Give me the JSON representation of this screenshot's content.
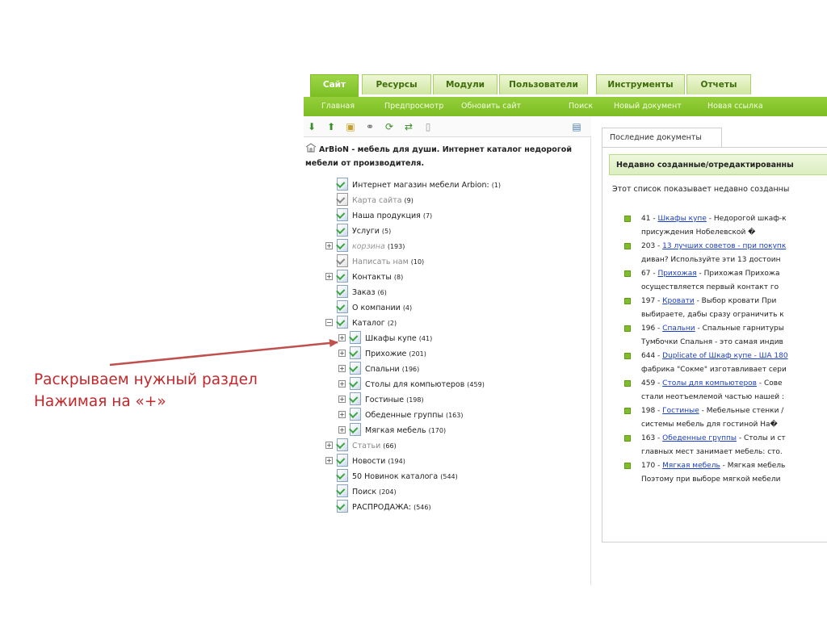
{
  "tabs": [
    {
      "label": "Сайт",
      "active": true
    },
    {
      "label": "Ресурсы"
    },
    {
      "label": "Модули"
    },
    {
      "label": "Пользователи"
    },
    {
      "label": "Инструменты"
    },
    {
      "label": "Отчеты"
    }
  ],
  "subnav": [
    "Главная",
    "Предпросмотр",
    "Обновить сайт",
    "Поиск",
    "Новый документ",
    "Новая ссылка"
  ],
  "tree": {
    "toolbar_icons": [
      "arrow-down-icon",
      "arrow-up-icon",
      "new-document-icon",
      "new-link-icon",
      "refresh-icon",
      "sort-icon",
      "trash-icon",
      "collapse-panel-icon"
    ],
    "root_title": "ArBioN - мебель для души. Интернет каталог недорогой мебели от производителя.",
    "nodes": [
      {
        "label": "Интернет магазин мебели Arbion:",
        "count": "(1)"
      },
      {
        "label": "Карта сайта",
        "count": "(9)"
      },
      {
        "label": "Наша продукция",
        "count": "(7)"
      },
      {
        "label": "Услуги",
        "count": "(5)"
      },
      {
        "label": "корзина",
        "count": "(193)"
      },
      {
        "label": "Написать нам",
        "count": "(10)"
      },
      {
        "label": "Контакты",
        "count": "(8)"
      },
      {
        "label": "Заказ",
        "count": "(6)"
      },
      {
        "label": "О компании",
        "count": "(4)"
      },
      {
        "label": "Каталог",
        "count": "(2)"
      },
      {
        "label": "Шкафы купе",
        "count": "(41)"
      },
      {
        "label": "Прихожие",
        "count": "(201)"
      },
      {
        "label": "Спальни",
        "count": "(196)"
      },
      {
        "label": "Столы для компьютеров",
        "count": "(459)"
      },
      {
        "label": "Гостиные",
        "count": "(198)"
      },
      {
        "label": "Обеденные группы",
        "count": "(163)"
      },
      {
        "label": "Мягкая мебель",
        "count": "(170)"
      },
      {
        "label": "Статьи",
        "count": "(66)"
      },
      {
        "label": "Новости",
        "count": "(194)"
      },
      {
        "label": "50 Новинок каталога",
        "count": "(544)"
      },
      {
        "label": "Поиск",
        "count": "(204)"
      },
      {
        "label": "РАСПРОДАЖА:",
        "count": "(546)"
      }
    ]
  },
  "recent": {
    "tab_label": "Последние документы",
    "header": "Недавно созданные/отредактированны",
    "intro": "Этот список показывает недавно созданны",
    "items": [
      {
        "id": "41",
        "link": "Шкафы купе",
        "rest": " -  Недорогой шкаф-к",
        "line2": "присуждения Нобелевской �"
      },
      {
        "id": "203",
        "link": "13 лучших советов - при покупк",
        "rest": "",
        "line2": "диван? Используйте эти 13 достоин"
      },
      {
        "id": "67",
        "link": "Прихожая",
        "rest": " - Прихожая    Прихожа",
        "line2": "осуществляется первый контакт го"
      },
      {
        "id": "197",
        "link": "Кровати",
        "rest": " - Выбор кровати  При",
        "line2": "выбираете, дабы сразу ограничить к"
      },
      {
        "id": "196",
        "link": "Спальни",
        "rest": " - Спальные гарнитуры",
        "line2": "Тумбочки Спальня - это самая индив"
      },
      {
        "id": "644",
        "link": "Duplicate of Шкаф купе - ША 180",
        "rest": "",
        "line2": "фабрика \"Сокме\" изготавливает сери"
      },
      {
        "id": "459",
        "link": "Столы для компьютеров",
        "rest": " - Сове",
        "line2": "стали неотъемлемой частью нашей :"
      },
      {
        "id": "198",
        "link": "Гостиные",
        "rest": " - Мебельные стенки /",
        "line2": "системы мебель для гостиной На�"
      },
      {
        "id": "163",
        "link": "Обеденные группы",
        "rest": " - Столы и ст",
        "line2": "главных мест занимает мебель: сто."
      },
      {
        "id": "170",
        "link": "Мягкая мебель",
        "rest": " - Мягкая мебель",
        "line2": "Поэтому при выборе мягкой мебели"
      }
    ]
  },
  "annotation": {
    "line1": "Раскрываем нужный раздел",
    "line2": "Нажимая на «+»"
  }
}
